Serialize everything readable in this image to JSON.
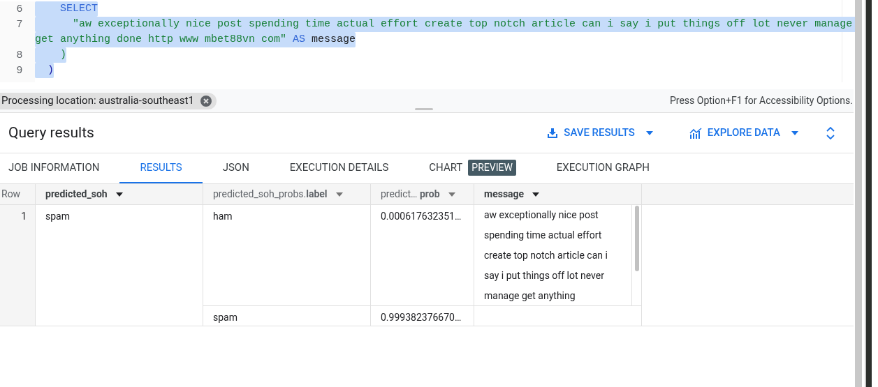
{
  "editor": {
    "lines": [
      {
        "number": "6",
        "rows": [
          [
            {
              "kind": "keyword",
              "text": "    SELECT"
            }
          ]
        ]
      },
      {
        "number": "7",
        "rows": [
          [
            {
              "kind": "string",
              "text": "      \"aw exceptionally nice post spending time actual effort create top notch article can i say i put things off lot never manage "
            }
          ],
          [
            {
              "kind": "string",
              "text": "get anything done http www mbet88vn com\""
            },
            {
              "kind": "keyword",
              "text": " AS"
            },
            {
              "kind": "plain",
              "text": " message"
            }
          ]
        ]
      },
      {
        "number": "8",
        "rows": [
          [
            {
              "kind": "paren",
              "text": "    )"
            }
          ]
        ]
      },
      {
        "number": "9",
        "rows": [
          [
            {
              "kind": "bracket",
              "text": "  )"
            }
          ]
        ]
      }
    ]
  },
  "status_bar": {
    "location_chip": "Processing location: australia-southeast1",
    "accessibility_hint": "Press Option+F1 for Accessibility Options."
  },
  "results": {
    "title": "Query results",
    "actions": [
      "SAVE RESULTS",
      "EXPLORE DATA"
    ],
    "tabs": [
      {
        "label": "JOB INFORMATION",
        "selected": false
      },
      {
        "label": "RESULTS",
        "selected": true
      },
      {
        "label": "JSON",
        "selected": false
      },
      {
        "label": "EXECUTION DETAILS",
        "selected": false
      },
      {
        "label": "CHART",
        "badge": "PREVIEW",
        "selected": false
      },
      {
        "label": "EXECUTION GRAPH",
        "selected": false
      }
    ],
    "table": {
      "row_header": "Row",
      "columns": [
        {
          "label": "predicted_soh",
          "nested": false
        },
        {
          "label": "predicted_soh_probs.**label**",
          "nested": true
        },
        {
          "label": "predict… **prob**",
          "nested": true
        },
        {
          "label": "message",
          "nested": false
        }
      ],
      "rows": [
        {
          "row": "1",
          "predicted_soh": "spam",
          "probs": [
            {
              "label": "ham",
              "prob": "0.000617632351…"
            },
            {
              "label": "spam",
              "prob": "0.999382376670…"
            }
          ],
          "message": "aw exceptionally nice post spending time actual effort create top notch article can i say i put things off lot never manage get anything"
        }
      ]
    }
  }
}
